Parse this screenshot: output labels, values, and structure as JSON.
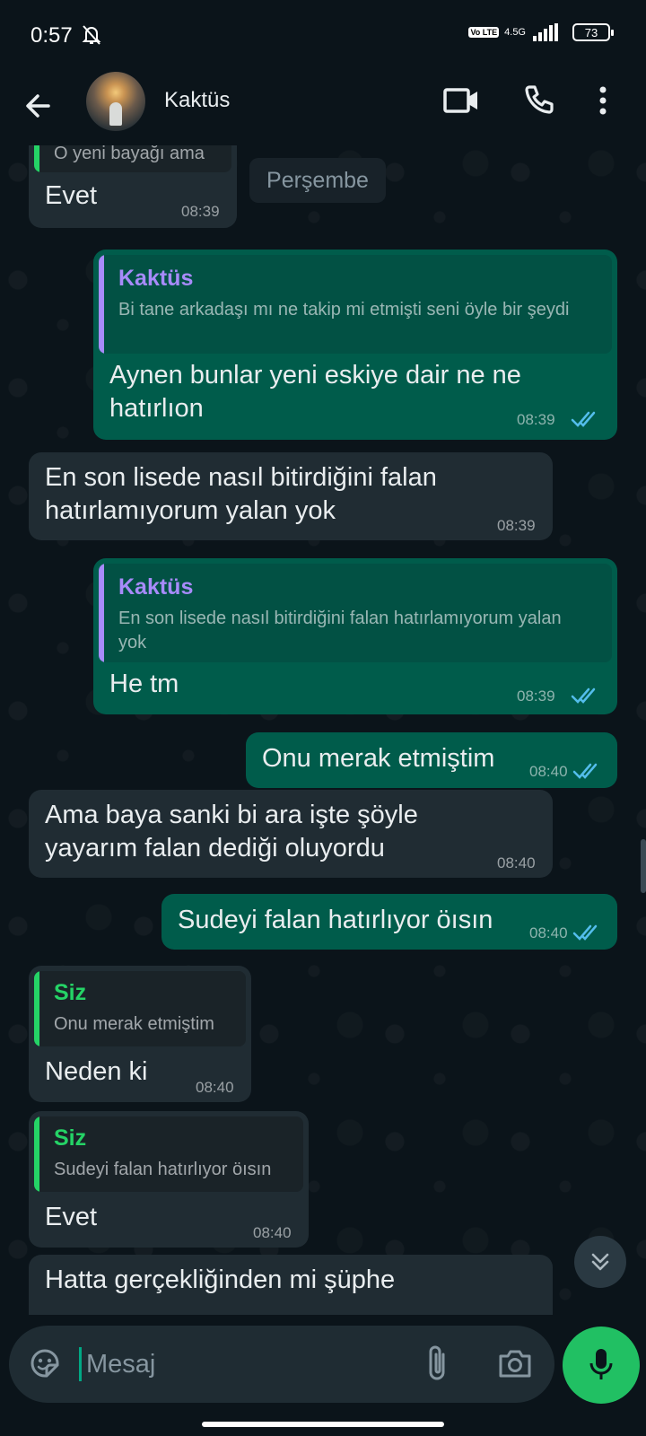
{
  "status_bar": {
    "time": "0:57",
    "network": "4.5G",
    "volte": "Vo LTE",
    "battery": "73"
  },
  "header": {
    "contact_name": "Kaktüs"
  },
  "day_chip": "Perşembe",
  "messages": [
    {
      "dir": "in",
      "quote": {
        "text": "O yeni bayağı ama"
      },
      "text": "Evet",
      "time": "08:39"
    },
    {
      "dir": "out",
      "quote": {
        "name": "Kaktüs",
        "text": "Bi tane arkadaşı mı ne takip mi etmişti seni öyle bir şeydi"
      },
      "text": "Aynen bunlar yeni eskiye dair ne ne hatırlıon",
      "time": "08:39"
    },
    {
      "dir": "in",
      "text": "En son lisede nasıl bitirdiğini falan hatırlamıyorum yalan yok",
      "time": "08:39"
    },
    {
      "dir": "out",
      "quote": {
        "name": "Kaktüs",
        "text": "En son lisede nasıl bitirdiğini falan hatırlamıyorum yalan yok"
      },
      "text": "He tm",
      "time": "08:39"
    },
    {
      "dir": "out",
      "text": "Onu merak etmiştim",
      "time": "08:40"
    },
    {
      "dir": "in",
      "text": "Ama baya sanki bi ara işte şöyle yayarım falan dediği oluyordu",
      "time": "08:40"
    },
    {
      "dir": "out",
      "text": "Sudeyi falan hatırlıyor öısın",
      "time": "08:40"
    },
    {
      "dir": "in",
      "quote": {
        "name": "Siz",
        "text": "Onu merak etmiştim"
      },
      "text": "Neden ki",
      "time": "08:40"
    },
    {
      "dir": "in",
      "quote": {
        "name": "Siz",
        "text": "Sudeyi falan hatırlıyor öısın"
      },
      "text": "Evet",
      "time": "08:40"
    },
    {
      "dir": "in",
      "text": "Hatta gerçekliğinden mi şüphe"
    }
  ],
  "input": {
    "placeholder": "Mesaj"
  },
  "colors": {
    "out_bubble": "#005c4b",
    "in_bubble": "#202c33",
    "accent": "#00a884",
    "quote_contact": "#a78bfa",
    "quote_self": "#25d366",
    "read_ticks": "#53bdeb",
    "mic": "#21c063"
  }
}
